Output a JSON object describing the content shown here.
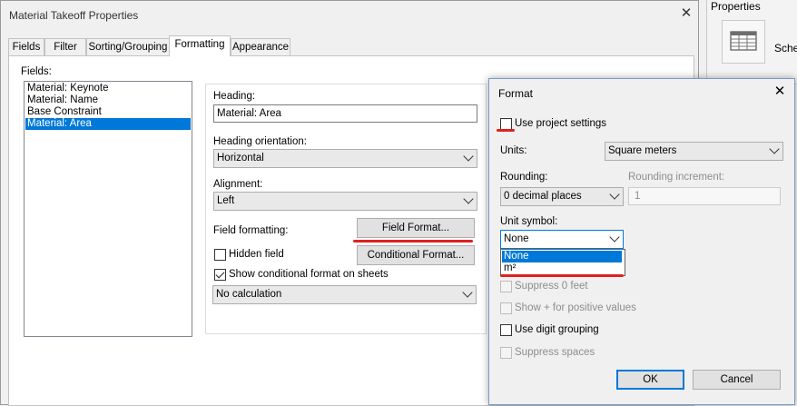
{
  "dialog": {
    "title": "Material Takeoff Properties",
    "close": "✕",
    "tabs": [
      "Fields",
      "Filter",
      "Sorting/Grouping",
      "Formatting",
      "Appearance"
    ],
    "active_tab": "Formatting"
  },
  "formatting": {
    "fields_label": "Fields:",
    "fields": [
      "Material: Keynote",
      "Material: Name",
      "Base Constraint",
      "Material: Area"
    ],
    "selected_field": "Material: Area",
    "heading_label": "Heading:",
    "heading_value": "Material: Area",
    "heading_orientation_label": "Heading orientation:",
    "heading_orientation_value": "Horizontal",
    "alignment_label": "Alignment:",
    "alignment_value": "Left",
    "field_formatting_label": "Field formatting:",
    "field_format_button": "Field Format...",
    "hidden_field_label": "Hidden field",
    "hidden_field_checked": false,
    "conditional_format_button": "Conditional  Format...",
    "show_conditional_label": "Show conditional format on sheets",
    "show_conditional_checked": true,
    "calculation_value": "No calculation"
  },
  "format_dialog": {
    "title": "Format",
    "close": "✕",
    "use_project_settings_label": "Use project settings",
    "use_project_settings_checked": false,
    "units_label": "Units:",
    "units_value": "Square meters",
    "rounding_label": "Rounding:",
    "rounding_value": "0 decimal places",
    "rounding_increment_label": "Rounding increment:",
    "rounding_increment_value": "1",
    "unit_symbol_label": "Unit symbol:",
    "unit_symbol_value": "None",
    "unit_symbol_options": [
      "None",
      "m²"
    ],
    "suppress_zero_label": "Suppress 0 feet",
    "show_plus_label": "Show + for positive values",
    "digit_grouping_label": "Use digit grouping",
    "suppress_spaces_label": "Suppress spaces",
    "ok_button": "OK",
    "cancel_button": "Cancel"
  },
  "properties_panel": {
    "title": "Properties",
    "schedule_label": "Sche"
  },
  "colors": {
    "selection": "#0078d7",
    "annotation_red": "#e02020"
  }
}
